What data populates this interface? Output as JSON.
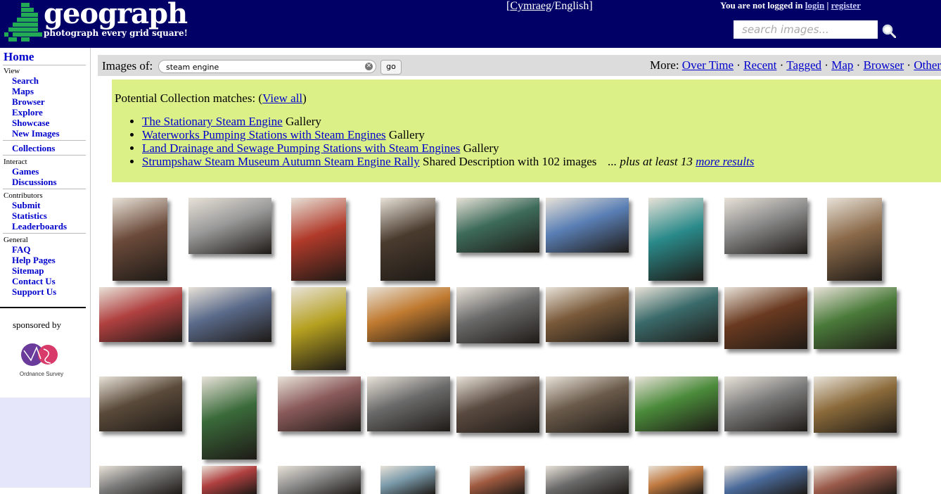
{
  "header": {
    "site_name": "geograph",
    "tagline": "photograph every grid square!",
    "lang_cymraeg": "Cymraeg",
    "lang_english": "English",
    "login_prefix": "You are not logged in",
    "login_link": "login",
    "register_link": "register",
    "search_placeholder": "search images..."
  },
  "sidebar": {
    "home": "Home",
    "view_label": "View",
    "view_items": [
      "Search",
      "Maps",
      "Browser",
      "Explore",
      "Showcase",
      "New Images"
    ],
    "collections": "Collections",
    "interact_label": "Interact",
    "interact_items": [
      "Games",
      "Discussions"
    ],
    "contributors_label": "Contributors",
    "contributors_items": [
      "Submit",
      "Statistics",
      "Leaderboards"
    ],
    "general_label": "General",
    "general_items": [
      "FAQ",
      "Help Pages",
      "Sitemap",
      "Contact Us",
      "Support Us"
    ],
    "sponsored_by": "sponsored by",
    "sponsor_name": "Ordnance Survey"
  },
  "search_bar": {
    "label": "Images of:",
    "query": "steam engine",
    "go_label": "go",
    "more_label": "More:",
    "more_links": [
      "Over Time",
      "Recent",
      "Tagged",
      "Map",
      "Browser",
      "Other"
    ]
  },
  "collections": {
    "heading_prefix": "Potential Collection matches: (",
    "view_all": "View all",
    "heading_suffix": ")",
    "items": [
      {
        "link": "The Stationary Steam Engine",
        "suffix": "Gallery"
      },
      {
        "link": "Waterworks Pumping Stations with Steam Engines",
        "suffix": "Gallery"
      },
      {
        "link": "Land Drainage and Sewage Pumping Stations with Steam Engines",
        "suffix": "Gallery"
      },
      {
        "link": "Strumpshaw Steam Museum Autumn Steam Engine Rally",
        "suffix": "Shared Description with 102 images"
      }
    ],
    "plus_text": "... plus at least 13",
    "more_results": "more results"
  },
  "colors": {
    "header_bg": "#000066",
    "link": "#0000cc",
    "collection_bg": "#dbf087",
    "bar_bg": "#dcdcdc",
    "sidebar_lower_bg": "#e6e6fa"
  },
  "thumbnails": [
    {
      "tone": "#6b4a3a"
    },
    {
      "tone": "#9a9a9a"
    },
    {
      "tone": "#b03a2a"
    },
    {
      "tone": "#4a3b2e"
    },
    {
      "tone": "#3d6b5a"
    },
    {
      "tone": "#5a7fb5"
    },
    {
      "tone": "#2a8a8a"
    },
    {
      "tone": "#8a8a8a"
    },
    {
      "tone": "#8b6a4a"
    },
    {
      "tone": "#b04040"
    },
    {
      "tone": "#5a6a8a"
    },
    {
      "tone": "#b5a020"
    },
    {
      "tone": "#c07a30"
    },
    {
      "tone": "#6a6a6a"
    },
    {
      "tone": "#7a5a3a"
    },
    {
      "tone": "#3a6a6a"
    },
    {
      "tone": "#6a3a20"
    },
    {
      "tone": "#4a7a3a"
    },
    {
      "tone": "#5a4a3a"
    },
    {
      "tone": "#3a6a3a"
    },
    {
      "tone": "#8a5a5a"
    },
    {
      "tone": "#6a6a6a"
    },
    {
      "tone": "#5a4a40"
    },
    {
      "tone": "#6a5a4a"
    },
    {
      "tone": "#4a8a3a"
    },
    {
      "tone": "#7a7a7a"
    },
    {
      "tone": "#8a6a3a"
    },
    {
      "tone": "#7a7a7a"
    },
    {
      "tone": "#b04040"
    },
    {
      "tone": "#8a8a8a"
    },
    {
      "tone": "#7a9aaa"
    },
    {
      "tone": "#a05a40"
    },
    {
      "tone": "#6a6a6a"
    },
    {
      "tone": "#c07a40"
    },
    {
      "tone": "#4a6a9a"
    },
    {
      "tone": "#9a5a4a"
    }
  ]
}
